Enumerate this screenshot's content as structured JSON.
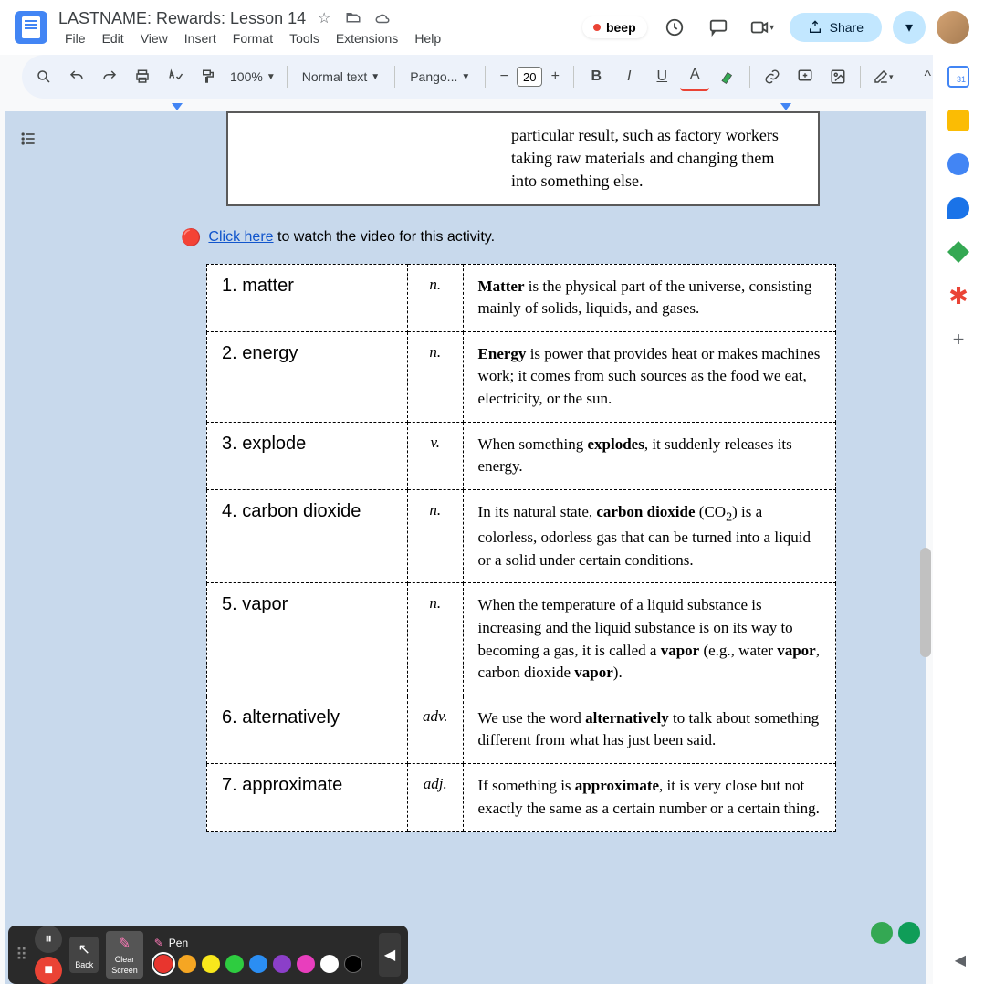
{
  "header": {
    "title": "LASTNAME: Rewards: Lesson 14",
    "menus": [
      "File",
      "Edit",
      "View",
      "Insert",
      "Format",
      "Tools",
      "Extensions",
      "Help"
    ],
    "beep": "beep",
    "share": "Share"
  },
  "toolbar": {
    "zoom": "100%",
    "style": "Normal text",
    "font": "Pango...",
    "font_size": "20"
  },
  "topbox": "particular result, such as factory workers taking raw materials and changing them into something else.",
  "video": {
    "emoji": "🔴",
    "link": "Click here",
    "rest": "to watch the video for this activity."
  },
  "vocab": [
    {
      "num": "1.",
      "term": "matter",
      "pos": "n.",
      "def_html": "<b>Matter</b> is the physical part of the universe, consisting mainly of solids, liquids, and gases."
    },
    {
      "num": "2.",
      "term": "energy",
      "pos": "n.",
      "def_html": "<b>Energy</b> is power that provides heat or makes machines work; it comes from such sources as the food we eat, electricity, or the sun."
    },
    {
      "num": "3.",
      "term": "explode",
      "pos": "v.",
      "def_html": "When something <b>explodes</b>, it suddenly releases its energy."
    },
    {
      "num": "4.",
      "term": "carbon dioxide",
      "pos": "n.",
      "def_html": "In its natural state, <b>carbon dioxide</b> (CO<sub>2</sub>) is a colorless, odorless gas that can be turned into a liquid or a solid under certain conditions."
    },
    {
      "num": "5.",
      "term": "vapor",
      "pos": "n.",
      "def_html": "When the temperature of a liquid substance is increasing and the liquid substance is on its way to becoming a gas, it is called a <b>vapor</b> (e.g., water <b>vapor</b>, carbon dioxide <b>vapor</b>)."
    },
    {
      "num": "6.",
      "term": "alternatively",
      "pos": "adv.",
      "def_html": "We use the word <b>alternatively</b> to talk about something different from what has just been said."
    },
    {
      "num": "7.",
      "term": "approximate",
      "pos": "adj.",
      "def_html": "If something is <b>approximate</b>, it is very close but not exactly the same as a certain number or a certain thing."
    }
  ],
  "annotation": {
    "back": "Back",
    "clear1": "Clear",
    "clear2": "Screen",
    "pen": "Pen",
    "colors": [
      {
        "hex": "#e8352e",
        "selected": true
      },
      {
        "hex": "#f5a623",
        "selected": false
      },
      {
        "hex": "#f8e71c",
        "selected": false
      },
      {
        "hex": "#2ecc40",
        "selected": false
      },
      {
        "hex": "#2b8ef3",
        "selected": false
      },
      {
        "hex": "#8b3fc9",
        "selected": false
      },
      {
        "hex": "#e83ebd",
        "selected": false
      },
      {
        "hex": "#ffffff",
        "selected": false
      },
      {
        "hex": "#000000",
        "selected": false
      }
    ]
  }
}
